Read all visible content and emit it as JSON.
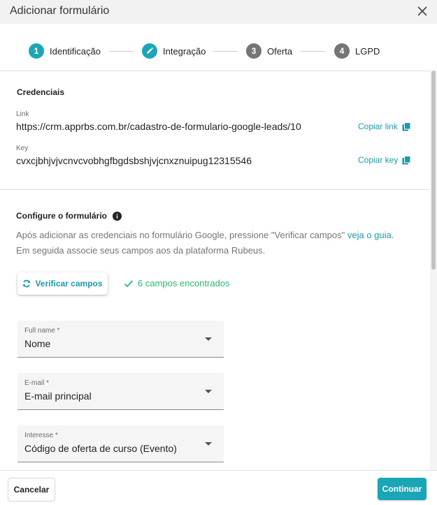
{
  "dialog": {
    "title": "Adicionar formulário"
  },
  "stepper": {
    "steps": [
      {
        "number": "1",
        "label": "Identificação",
        "state": "done"
      },
      {
        "number": "",
        "label": "Integração",
        "state": "active"
      },
      {
        "number": "3",
        "label": "Oferta",
        "state": "pending"
      },
      {
        "number": "4",
        "label": "LGPD",
        "state": "pending"
      }
    ]
  },
  "credentials": {
    "title": "Credenciais",
    "link_caption": "Link",
    "link_value": "https://crm.apprbs.com.br/cadastro-de-formulario-google-leads/10",
    "copy_link_label": "Copiar link",
    "key_caption": "Key",
    "key_value": "cvxcjbhjvjvcnvcvobhgfbgdsbshjvjcnxznuipug12315546",
    "copy_key_label": "Copiar key"
  },
  "configure": {
    "title": "Configure o formulário",
    "info_line1_prefix": "Após adicionar as credenciais no formulário Google, pressione \"Verificar campos\" ",
    "guide_link": "veja o guia",
    "info_line1_suffix": ".",
    "info_line2": "Em seguida associe seus campos aos da plataforma Rubeus.",
    "verify_button": "Verificar campos",
    "found_text": "6 campos encontrados"
  },
  "fields": [
    {
      "label": "Full name *",
      "value": "Nome"
    },
    {
      "label": "E-mail *",
      "value": "E-mail principal"
    },
    {
      "label": "Interesse *",
      "value": "Código de oferta de curso (Evento)"
    }
  ],
  "footer": {
    "cancel": "Cancelar",
    "continue": "Continuar"
  },
  "colors": {
    "accent": "#1aa6b7",
    "success": "#2bb673",
    "inactive_step": "#757575"
  }
}
